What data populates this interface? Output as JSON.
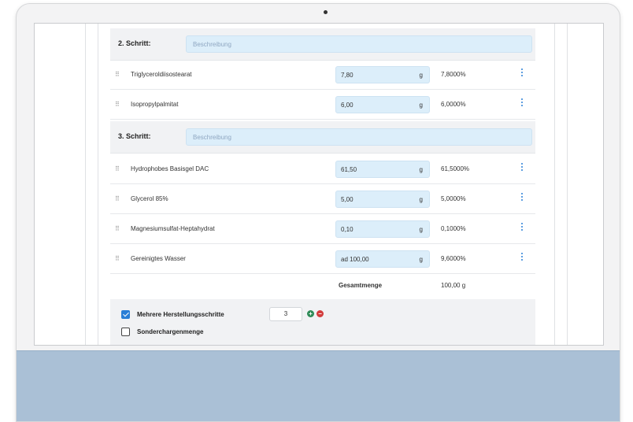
{
  "steps": [
    {
      "label": "2. Schritt:",
      "placeholder": "Beschreibung"
    },
    {
      "label": "3. Schritt:",
      "placeholder": "Beschreibung"
    }
  ],
  "ingredients": [
    {
      "name": "Triglyceroldiisostearat",
      "amount": "7,80",
      "unit": "g",
      "percent": "7,8000%"
    },
    {
      "name": "Isopropylpalmitat",
      "amount": "6,00",
      "unit": "g",
      "percent": "6,0000%"
    },
    {
      "name": "Hydrophobes Basisgel DAC",
      "amount": "61,50",
      "unit": "g",
      "percent": "61,5000%"
    },
    {
      "name": "Glycerol 85%",
      "amount": "5,00",
      "unit": "g",
      "percent": "5,0000%"
    },
    {
      "name": "Magnesiumsulfat-Heptahydrat",
      "amount": "0,10",
      "unit": "g",
      "percent": "0,1000%"
    },
    {
      "name": "Gereinigtes Wasser",
      "amount": "ad 100,00",
      "unit": "g",
      "percent": "9,6000%"
    }
  ],
  "total": {
    "label": "Gesamtmenge",
    "value": "100,00 g"
  },
  "options": {
    "multi_steps_label": "Mehrere Herstellungsschritte",
    "multi_steps_checked": true,
    "steps_count": "3",
    "special_batch_label": "Sonderchargenmenge",
    "special_batch_checked": false
  },
  "colors": {
    "accent": "#2a7fd6",
    "input_bg": "#dceefa",
    "chin": "#aac0d6"
  }
}
